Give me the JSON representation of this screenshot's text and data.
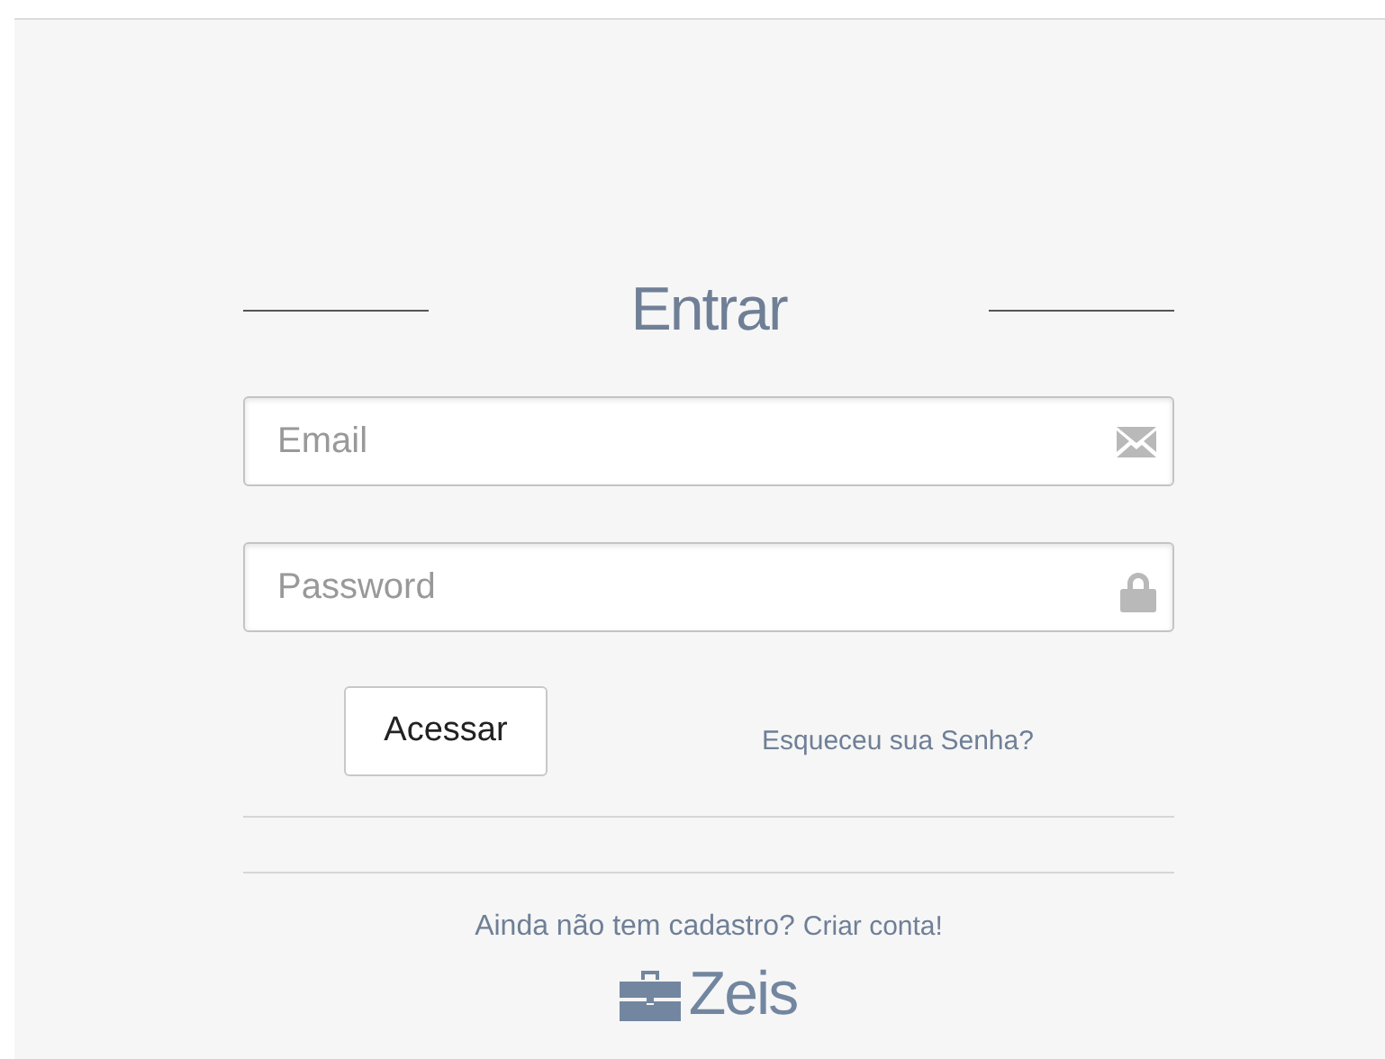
{
  "heading": "Entrar",
  "fields": [
    {
      "placeholder": "Email",
      "kind": "email"
    },
    {
      "placeholder": "Password",
      "kind": "password"
    }
  ],
  "submit_button": "Acessar",
  "forgot_link": "Esqueceu sua Senha?",
  "signup": {
    "text": "Ainda não tem cadastro?",
    "link": "Criar conta!"
  },
  "logo": {
    "text": "Zeis"
  }
}
